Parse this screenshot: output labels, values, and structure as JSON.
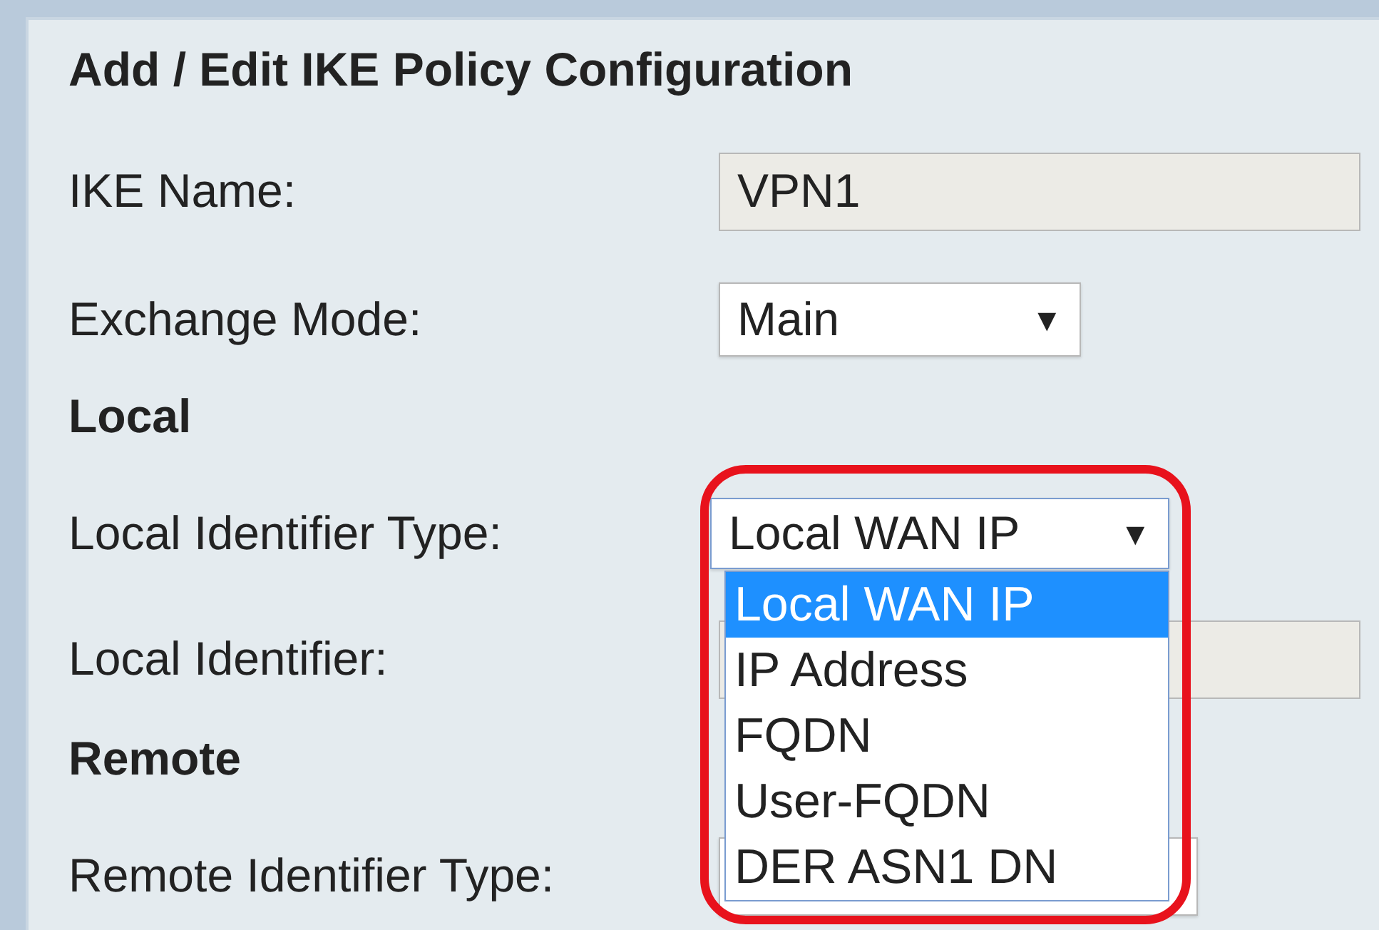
{
  "title": "Add / Edit IKE Policy Configuration",
  "rows": [
    {
      "kind": "text",
      "label": "IKE Name:",
      "value": "VPN1",
      "disabled": true
    },
    {
      "kind": "select",
      "label": "Exchange Mode:",
      "value": "Main",
      "arrow": "▼"
    },
    {
      "kind": "heading",
      "label": "Local"
    },
    {
      "kind": "select",
      "label": "Local Identifier Type:",
      "value": "Local WAN IP",
      "arrow": "▼",
      "expanded": true,
      "highlighted": true,
      "options": [
        {
          "label": "Local WAN IP",
          "selected": true
        },
        {
          "label": "IP Address",
          "selected": false
        },
        {
          "label": "FQDN",
          "selected": false
        },
        {
          "label": "User-FQDN",
          "selected": false
        },
        {
          "label": "DER ASN1 DN",
          "selected": false
        }
      ]
    },
    {
      "kind": "text",
      "label": "Local Identifier:",
      "disabled": true
    },
    {
      "kind": "heading",
      "label": "Remote"
    },
    {
      "kind": "select",
      "label": "Remote Identifier Type:"
    }
  ]
}
